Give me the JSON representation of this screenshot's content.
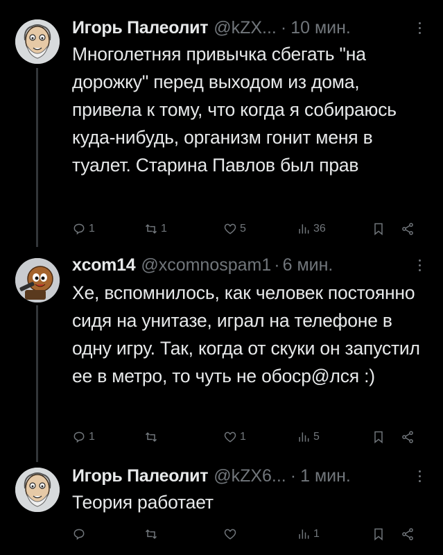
{
  "tweets": [
    {
      "author": "Игорь Палеолит",
      "handle": "@kZX...",
      "time": "10 мин.",
      "text": "Многолетняя привычка сбегать \"на дорожку\" перед выходом из дома, привела к тому, что когда я собираюсь куда-нибудь, организм гонит меня в туалет. Старина Павлов был прав",
      "replies": "1",
      "retweets": "1",
      "likes": "5",
      "views": "36"
    },
    {
      "author": "xcom14",
      "handle": "@xcomnospam1",
      "time": "6 мин.",
      "text": "Хе, вспомнилось, как человек постоянно сидя на унитазе, играл на телефоне в одну игру. Так, когда от скуки он запустил ее в метро, то чуть не обоср@лся :)",
      "replies": "1",
      "retweets": "",
      "likes": "1",
      "views": "5"
    },
    {
      "author": "Игорь Палеолит",
      "handle": "@kZX6...",
      "time": "1 мин.",
      "text": "Теория работает",
      "replies": "",
      "retweets": "",
      "likes": "",
      "views": "1"
    }
  ],
  "icons": [
    "reply-icon",
    "retweet-icon",
    "like-icon",
    "views-icon",
    "bookmark-icon",
    "share-icon",
    "more-icon"
  ]
}
